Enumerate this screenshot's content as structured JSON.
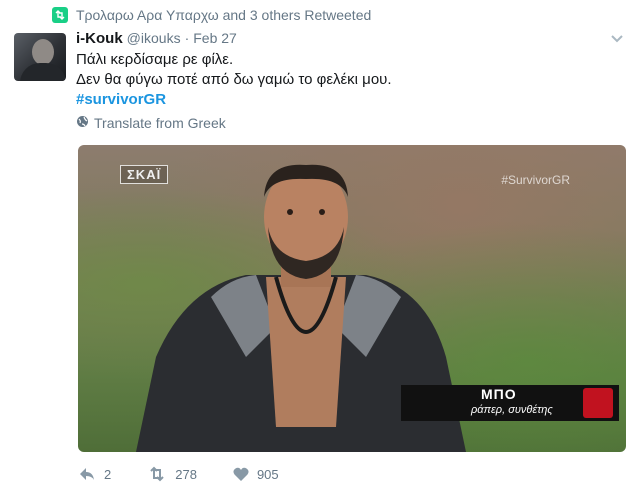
{
  "retweet_context": {
    "text": "Τρολαρω Αρα Υπαρχω and 3 others Retweeted",
    "icon": "retweet-icon",
    "color": "#19cf86"
  },
  "tweet": {
    "name": "i-Kouk",
    "handle": "@ikouks",
    "separator": "·",
    "date": "Feb 27",
    "lines": [
      "Πάλι κερδίσαμε ρε φίλε.",
      "Δεν θα φύγω ποτέ από δω γαμώ το φελέκι μου."
    ],
    "hashtag": "#survivorGR",
    "hashtag_color": "#1b95e0",
    "translate_label": "Translate from Greek"
  },
  "media": {
    "channel_logo": "ΣΚΑΪ",
    "watermark": "#SurvivorGR",
    "lower_third_title": "ΜΠΟ",
    "lower_third_subtitle": "ράπερ, συνθέτης"
  },
  "actions": {
    "reply_count": "2",
    "retweet_count": "278",
    "like_count": "905"
  }
}
